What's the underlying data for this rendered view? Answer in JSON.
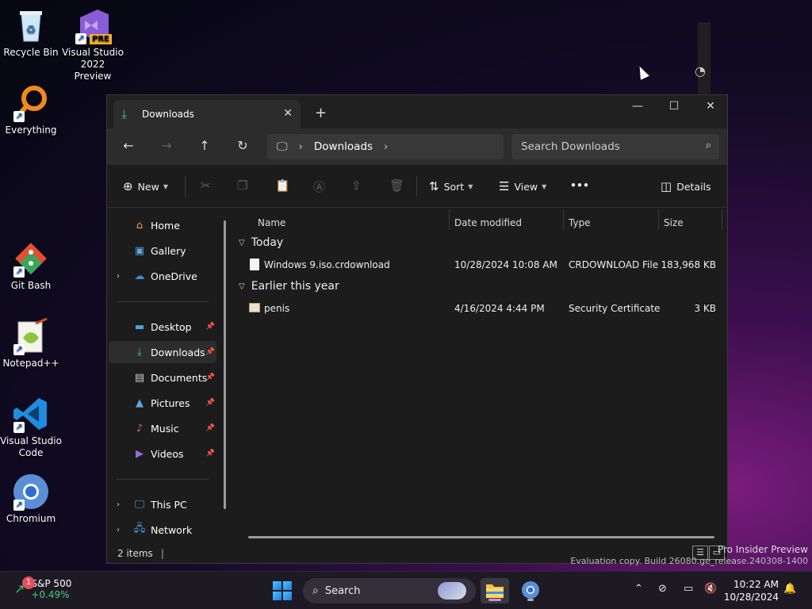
{
  "desktop": {
    "icons": [
      {
        "label": "Recycle Bin"
      },
      {
        "label": "Visual Studio 2022 Preview",
        "badge": "PRE"
      },
      {
        "label": "Everything"
      },
      {
        "label": "Git Bash"
      },
      {
        "label": "Notepad++"
      },
      {
        "label": "Visual Studio Code"
      },
      {
        "label": "Chromium"
      }
    ],
    "watermark_line1": "Pro Insider Preview",
    "watermark_line2": "Evaluation copy. Build 26080.ge_release.240308-1400"
  },
  "explorer": {
    "tab_title": "Downloads",
    "address": {
      "location": "Downloads"
    },
    "search_placeholder": "Search Downloads",
    "commands": {
      "new": "New",
      "sort": "Sort",
      "view": "View",
      "more": "•••",
      "details": "Details"
    },
    "sidebar": {
      "home": "Home",
      "gallery": "Gallery",
      "onedrive": "OneDrive",
      "desktop": "Desktop",
      "downloads": "Downloads",
      "documents": "Documents",
      "pictures": "Pictures",
      "music": "Music",
      "videos": "Videos",
      "this_pc": "This PC",
      "network": "Network"
    },
    "columns": {
      "name": "Name",
      "date": "Date modified",
      "type": "Type",
      "size": "Size"
    },
    "groups": [
      {
        "label": "Today",
        "files": [
          {
            "name": "Windows 9.iso.crdownload",
            "date": "10/28/2024 10:08 AM",
            "type": "CRDOWNLOAD File",
            "size": "183,968 KB"
          }
        ]
      },
      {
        "label": "Earlier this year",
        "files": [
          {
            "name": "penis",
            "date": "4/16/2024 4:44 PM",
            "type": "Security Certificate",
            "size": "3 KB"
          }
        ]
      }
    ],
    "status": "2 items"
  },
  "taskbar": {
    "stock": {
      "name": "S&P 500",
      "change": "+0.49%",
      "badge": "1"
    },
    "search_label": "Search",
    "time": "10:22 AM",
    "date": "10/28/2024"
  }
}
